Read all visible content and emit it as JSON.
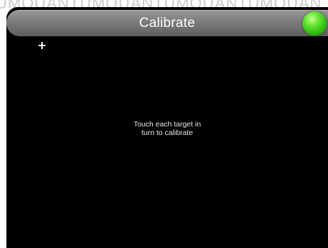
{
  "window": {
    "title": "Calibrate"
  },
  "watermark": {
    "text": "UMOUANTUMOUANTUMOUANTUMOUAN"
  },
  "status": {
    "indicator_icon": "green-status-led-icon",
    "color": "#33c414"
  },
  "calibration": {
    "target_icon": "crosshair-target-icon",
    "instruction_line1": "Touch each target in",
    "instruction_line2": "turn to calibrate"
  },
  "colors": {
    "screen_background": "#000000",
    "titlebar": "#7c7c7c",
    "text": "#ffffff"
  }
}
